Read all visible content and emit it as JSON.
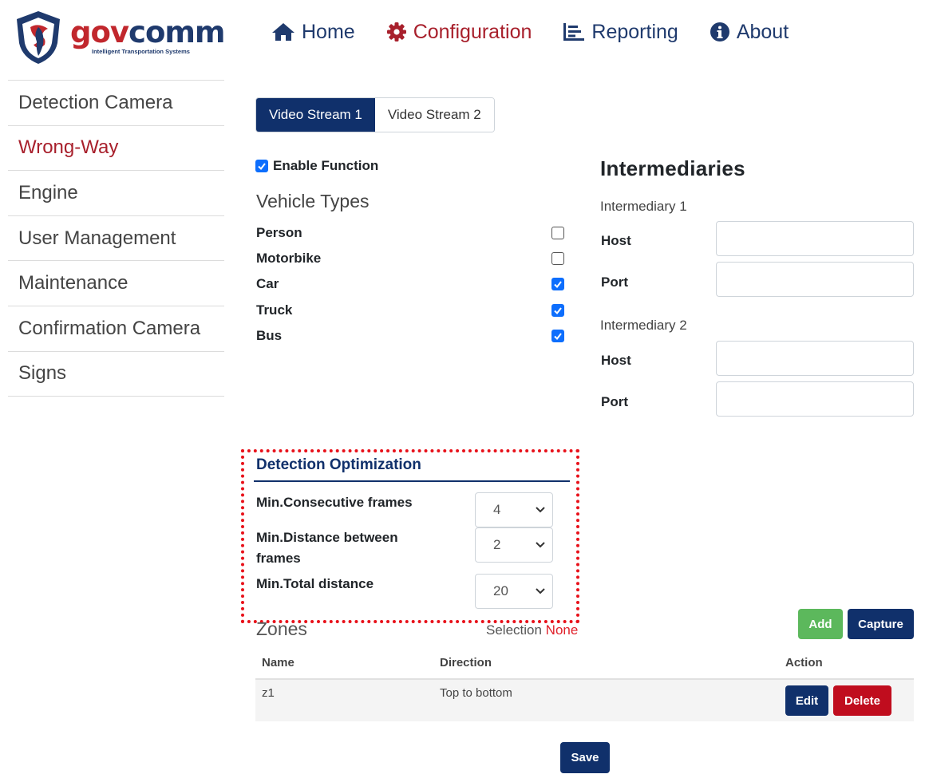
{
  "logo": {
    "brand_gov": "gov",
    "brand_comm": "comm",
    "tagline": "Intelligent Transportation Systems"
  },
  "nav": {
    "home": "Home",
    "configuration": "Configuration",
    "reporting": "Reporting",
    "about": "About",
    "active": "Configuration"
  },
  "sidebar": {
    "items": [
      {
        "label": "Detection Camera"
      },
      {
        "label": "Wrong-Way"
      },
      {
        "label": "Engine"
      },
      {
        "label": "User Management"
      },
      {
        "label": "Maintenance"
      },
      {
        "label": "Confirmation Camera"
      },
      {
        "label": "Signs"
      }
    ],
    "active": "Wrong-Way"
  },
  "streams": {
    "tab1": "Video Stream 1",
    "tab2": "Video Stream 2",
    "active": "Video Stream 1"
  },
  "function": {
    "enable_label": "Enable Function",
    "enabled": true
  },
  "vehicle_types": {
    "title": "Vehicle Types",
    "items": [
      {
        "label": "Person",
        "checked": false
      },
      {
        "label": "Motorbike",
        "checked": false
      },
      {
        "label": "Car",
        "checked": true
      },
      {
        "label": "Truck",
        "checked": true
      },
      {
        "label": "Bus",
        "checked": true
      }
    ]
  },
  "intermediaries": {
    "title": "Intermediaries",
    "i1": {
      "title": "Intermediary 1",
      "host_label": "Host",
      "port_label": "Port",
      "host": "",
      "port": ""
    },
    "i2": {
      "title": "Intermediary 2",
      "host_label": "Host",
      "port_label": "Port",
      "host": "",
      "port": ""
    }
  },
  "optimization": {
    "title": "Detection Optimization",
    "consecutive": {
      "label": "Min.Consecutive frames",
      "value": "4"
    },
    "distance_between": {
      "label": "Min.Distance between frames",
      "value": "2"
    },
    "total_distance": {
      "label": "Min.Total distance",
      "value": "20"
    }
  },
  "zones": {
    "title": "Zones",
    "selection_label": "Selection",
    "selection_value": "None",
    "add_label": "Add",
    "capture_label": "Capture",
    "columns": {
      "name": "Name",
      "direction": "Direction",
      "action": "Action"
    },
    "rows": [
      {
        "name": "z1",
        "direction": "Top to bottom"
      }
    ],
    "edit_label": "Edit",
    "delete_label": "Delete"
  },
  "save_label": "Save",
  "colors": {
    "navy": "#10306b",
    "red": "#a8202c",
    "green": "#5cb85c",
    "checkbox_blue": "#0d6efd",
    "highlight": "#e8111a"
  }
}
